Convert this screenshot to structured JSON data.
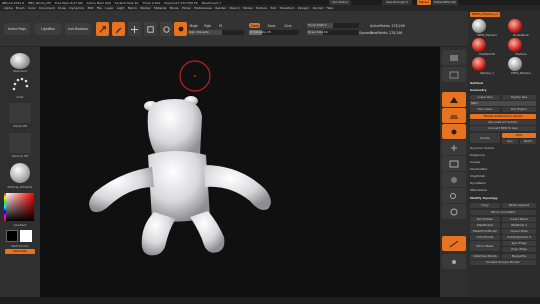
{
  "titlebar": {
    "items": [
      "ZBrush 2021.6",
      "ZB2_Panda_M3",
      "Free Mem 8.07 GB",
      "Active Mem 944",
      "Scratch Disk 40",
      "Timer 0.012",
      "PolyCount 272.558 KP",
      "MeshCount 1"
    ],
    "quicksave": "QuickSave",
    "see_through": "See-through 0",
    "menus": "Menus",
    "script": "DefaultZScript"
  },
  "menubar": {
    "items": [
      "Alpha",
      "Brush",
      "Color",
      "Document",
      "Draw",
      "Dynamics",
      "Edit",
      "File",
      "Layer",
      "Light",
      "Macro",
      "Marker",
      "Material",
      "Movie",
      "Picker",
      "Preferences",
      "Render",
      "Stencil",
      "Stroke",
      "Texture",
      "Tool",
      "Transform",
      "Zplugin",
      "Zscript",
      "Help"
    ]
  },
  "toolbar": {
    "home_page": "Home Page",
    "lightbox": "LightBox",
    "live_boolean": "Live Boolean",
    "edit": "Edit",
    "draw": "Draw",
    "move": "Move",
    "scale": "Scale",
    "rotate": "Rotate",
    "mrgb": "Mrgb",
    "rgb": "Rgb",
    "m": "M",
    "rgb_intensity": "Rgb Intensity",
    "zadd": "Zadd",
    "zsub": "Zsub",
    "zcut": "Zcut",
    "z_intensity": "Z Intensity 25",
    "focal_shift": "Focal Shift 0",
    "draw_size": "Draw Size 64",
    "dynamic": "Dynamic",
    "active_points": "ActivePoints: 278,246",
    "total_points": "TotalPoints: 278,246"
  },
  "leftshelf": {
    "brush_label": "Standard",
    "stroke_label": "Dots",
    "alpha_label": "Alpha Off",
    "texture_label": "Texture Off",
    "material_label": "MatCap White01",
    "gradient_label": "Gradient",
    "switch_color_label": "SwitchColor",
    "alternate_label": "Alternate"
  },
  "rightshelf": {
    "bpr": "BPR",
    "spix": "SPix 3",
    "persp": "Persp",
    "floor": "Floor",
    "local": "Local",
    "xyz": "Xyz",
    "frame": "Frame",
    "move": "Move",
    "zoom": "Zoom3D",
    "rotate": "Rotate",
    "transp": "Transp",
    "solo": "Solo"
  },
  "rightpanel": {
    "header_tool": "PM3D_ZSphere_1",
    "thumbs": [
      "PM3D_ZSphere",
      "SimpleBrush",
      "PolyMesh3D",
      "ZSphere",
      "ZSphere_1",
      "PM3D_ZSphere"
    ],
    "subtool": "Subtool",
    "geometry": "Geometry",
    "lower_res": "Lower Res",
    "higher_res": "Higher Res",
    "sdiv": "SDiv",
    "del_lower": "Del Lower",
    "del_higher": "Del Higher",
    "freeze_subdiv": "Freeze SubDivision Levels",
    "reconstruct_subdiv": "Reconstruct Subdiv",
    "convert_bpr": "Convert BPR To Geo",
    "divide": "Divide",
    "smt": "Smt",
    "suv": "Suv",
    "rsmt": "ReUV",
    "dynamic_subdiv": "Dynamic Subdiv",
    "edgeloop": "EdgeLoop",
    "crease": "Crease",
    "shadowbox": "ShadowBox",
    "claypolish": "ClayPolish",
    "dynamesh": "DynaMesh",
    "zremesher": "ZRemesher",
    "modify_topology": "Modify Topology",
    "copy": "Copy",
    "paste_append": "Paste Append",
    "mirror_weld": "Mirror And Weld",
    "del_hidden": "Del Hidden",
    "insert_mesh": "Insert Mesh",
    "weld_points": "WeldPoints",
    "weld_dist": "WeldDist 1",
    "mesh_from_brush": "MeshFromBrush",
    "close_holes": "Close Holes",
    "grid_divide": "Grid Divide",
    "sub_segments": "SubSegments 0",
    "micro_mesh": "Micro Mesh",
    "spin_edge": "Spin Edge",
    "align_edge": "Align Edge",
    "optimize_points": "Optimize Points",
    "merge_tris": "MergeTris",
    "unweld_groups": "Unweld Groups Border"
  },
  "colors": {
    "accent": "#e8731f",
    "panel": "#2c2c2c",
    "viewport": "#101010",
    "model": "#e8e8ec"
  }
}
